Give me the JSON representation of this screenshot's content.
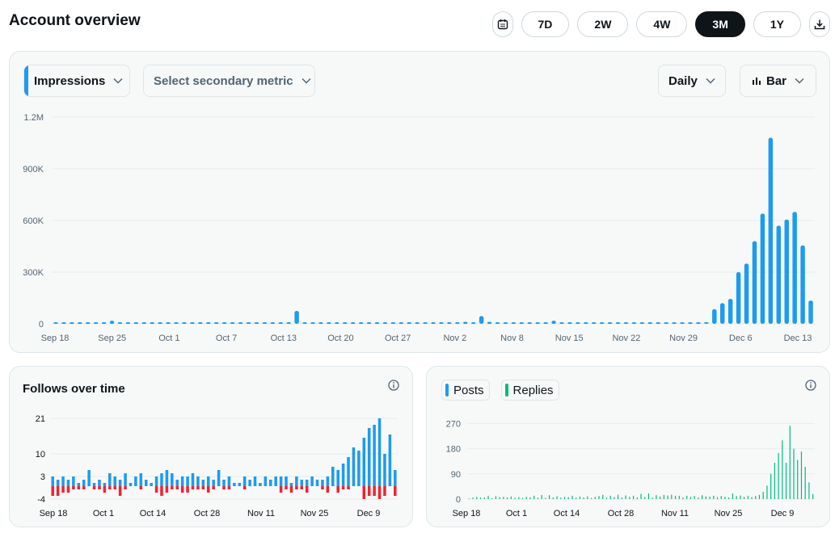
{
  "page": {
    "title": "Account overview"
  },
  "toolbar": {
    "ranges": [
      "7D",
      "2W",
      "4W",
      "3M",
      "1Y"
    ],
    "active_range": "3M",
    "calendar_icon": "calendar-icon",
    "download_icon": "download-icon"
  },
  "main_panel": {
    "primary_metric": "Impressions",
    "secondary_metric_placeholder": "Select secondary metric",
    "granularity": "Daily",
    "chart_style": "Bar"
  },
  "follows_panel": {
    "title": "Follows over time"
  },
  "posts_panel": {
    "legend": [
      "Posts",
      "Replies"
    ]
  },
  "colors": {
    "accent": "#1d9bf0",
    "negative": "#f4212e",
    "replies": "#00ba7c",
    "active": "#0f1419"
  },
  "chart_data": [
    {
      "type": "bar",
      "name": "impressions",
      "y_ticks": [
        "1.2M",
        "900K",
        "600K",
        "300K",
        "0"
      ],
      "y_tick_values": [
        1200000,
        900000,
        600000,
        300000,
        0
      ],
      "x_tick_labels": [
        "Sep 18",
        "Sep 25",
        "Oct 1",
        "Oct 7",
        "Oct 13",
        "Oct 20",
        "Oct 27",
        "Nov 2",
        "Nov 8",
        "Nov 15",
        "Nov 22",
        "Nov 29",
        "Dec 6",
        "Dec 13"
      ],
      "ylim": [
        0,
        1200000
      ],
      "values": [
        2000,
        3000,
        1500,
        2500,
        2000,
        9000,
        4000,
        18000,
        5000,
        3000,
        6000,
        3000,
        2000,
        2500,
        2000,
        2500,
        2000,
        1800,
        2200,
        5000,
        3000,
        4000,
        3000,
        2500,
        2000,
        1500,
        2000,
        3000,
        4000,
        2000,
        75000,
        6000,
        2000,
        1500,
        3000,
        5000,
        3000,
        2000,
        3000,
        1500,
        2000,
        6000,
        3000,
        2000,
        1500,
        4000,
        5000,
        3000,
        1500,
        1200,
        3000,
        12000,
        3000,
        45000,
        12000,
        2000,
        2000,
        1500,
        2000,
        2500,
        1500,
        3000,
        18000,
        5000,
        2000,
        1500,
        1500,
        2000,
        2000,
        1500,
        1200,
        1500,
        1200,
        1000,
        1500,
        1200,
        1500,
        2000,
        1800,
        1200,
        1500,
        10000,
        85000,
        120000,
        145000,
        300000,
        350000,
        480000,
        640000,
        1080000,
        570000,
        605000,
        650000,
        455000,
        135000
      ]
    },
    {
      "type": "bar",
      "name": "follows",
      "y_ticks": [
        "21",
        "10",
        "3",
        "-4"
      ],
      "y_tick_values": [
        21,
        10,
        3,
        -4
      ],
      "x_tick_labels": [
        "Sep 18",
        "Oct 1",
        "Oct 14",
        "Oct 28",
        "Nov 11",
        "Nov 25",
        "Dec 9"
      ],
      "ylim": [
        -4,
        21
      ],
      "values": [
        3,
        2,
        3,
        2,
        3,
        1,
        2,
        5,
        1,
        2,
        1,
        4,
        3,
        2,
        4,
        1,
        3,
        4,
        2,
        1,
        3,
        4,
        5,
        4,
        2,
        3,
        3,
        4,
        3,
        2,
        3,
        2,
        5,
        2,
        3,
        1,
        1,
        3,
        2,
        3,
        1,
        3,
        2,
        3,
        3,
        3,
        1,
        3,
        2,
        2,
        3,
        2,
        2,
        3,
        6,
        5,
        7,
        9,
        12,
        11,
        15,
        18,
        19,
        21,
        10,
        16,
        5
      ],
      "negatives": [
        -3,
        -3,
        -2,
        -2,
        -1,
        -1,
        -1,
        0,
        -1,
        -1,
        -2,
        -1,
        -1,
        -3,
        -1,
        0,
        0,
        -1,
        0,
        0,
        -2,
        -3,
        -2,
        -1,
        -1,
        -2,
        -2,
        -1,
        -1,
        -1,
        -2,
        -1,
        0,
        -1,
        -1,
        0,
        0,
        -1,
        0,
        0,
        0,
        0,
        0,
        0,
        -2,
        -1,
        -2,
        -1,
        -1,
        -2,
        0,
        0,
        -1,
        -2,
        0,
        -2,
        -1,
        -1,
        0,
        0,
        -4,
        -3,
        -3,
        -4,
        -3,
        0,
        -3
      ]
    },
    {
      "type": "bar",
      "name": "posts_replies",
      "y_ticks": [
        "270",
        "180",
        "90",
        "0"
      ],
      "y_tick_values": [
        270,
        180,
        90,
        0
      ],
      "x_tick_labels": [
        "Sep 18",
        "Oct 1",
        "Oct 14",
        "Oct 28",
        "Nov 11",
        "Nov 25",
        "Dec 9"
      ],
      "ylim": [
        0,
        280
      ],
      "series": [
        {
          "name": "Replies",
          "values": [
            2,
            5,
            8,
            5,
            6,
            12,
            3,
            10,
            7,
            8,
            6,
            9,
            5,
            7,
            4,
            8,
            6,
            12,
            5,
            15,
            4,
            14,
            6,
            10,
            5,
            8,
            7,
            12,
            5,
            9,
            6,
            10,
            4,
            8,
            11,
            15,
            5,
            12,
            7,
            16,
            6,
            13,
            8,
            12,
            6,
            18,
            8,
            20,
            5,
            14,
            9,
            15,
            13,
            16,
            12,
            12,
            6,
            12,
            8,
            11,
            5,
            14,
            10,
            9,
            12,
            7,
            11,
            8,
            6,
            20,
            11,
            13,
            8,
            12,
            7,
            11,
            15,
            26,
            48,
            90,
            130,
            165,
            210,
            130,
            262,
            180,
            140,
            170,
            115,
            60,
            18
          ]
        }
      ]
    }
  ]
}
